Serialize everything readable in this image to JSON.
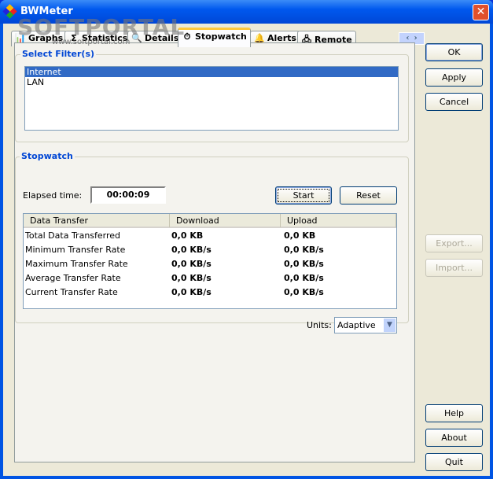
{
  "window": {
    "title": "BWMeter",
    "close": "✕"
  },
  "watermark": {
    "text": "SOFTPORTAL",
    "url": "www.softportal.com"
  },
  "tabs": [
    {
      "label": "Graphs",
      "icon": "📊"
    },
    {
      "label": "Statistics",
      "icon": "Σ"
    },
    {
      "label": "Details",
      "icon": "🔍"
    },
    {
      "label": "Stopwatch",
      "icon": "⏱"
    },
    {
      "label": "Alerts",
      "icon": "🔔"
    },
    {
      "label": "Remote",
      "icon": "🖧"
    }
  ],
  "tab_scroll": {
    "left": "‹",
    "right": "›"
  },
  "filters": {
    "title": "Select Filter(s)",
    "items": [
      "Internet",
      "LAN"
    ],
    "selected": "Internet"
  },
  "stopwatch": {
    "title": "Stopwatch",
    "elapsed_label": "Elapsed time:",
    "elapsed": "00:00:09",
    "start": "Start",
    "reset": "Reset",
    "columns": [
      "Data Transfer",
      "Download",
      "Upload"
    ],
    "rows": [
      [
        "Total Data Transferred",
        "0,0 KB",
        "0,0 KB"
      ],
      [
        "Minimum Transfer Rate",
        "0,0 KB/s",
        "0,0 KB/s"
      ],
      [
        "Maximum Transfer Rate",
        "0,0 KB/s",
        "0,0 KB/s"
      ],
      [
        "Average Transfer Rate",
        "0,0 KB/s",
        "0,0 KB/s"
      ],
      [
        "Current Transfer Rate",
        "0,0 KB/s",
        "0,0 KB/s"
      ]
    ],
    "units_label": "Units:",
    "units": "Adaptive"
  },
  "buttons": {
    "ok": "OK",
    "apply": "Apply",
    "cancel": "Cancel",
    "export": "Export...",
    "import": "Import...",
    "help": "Help",
    "about": "About",
    "quit": "Quit"
  }
}
